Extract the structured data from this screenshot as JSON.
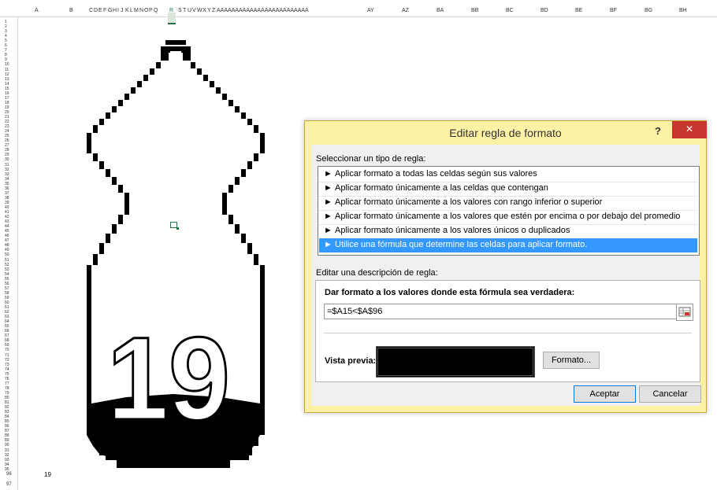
{
  "sheet": {
    "column_headers": [
      "A",
      "B",
      "C",
      "D",
      "E",
      "F",
      "G",
      "H",
      "I",
      "J",
      "K",
      "L",
      "M",
      "N",
      "O",
      "P",
      "Q",
      "R",
      "S",
      "T",
      "U",
      "V",
      "W",
      "X",
      "Y",
      "Z",
      "AAAAAAAAAAAAAAAAAAAAAAAAA",
      "AY",
      "AZ",
      "BA",
      "BB",
      "BC",
      "BD",
      "BE",
      "BF",
      "BG",
      "BH"
    ],
    "row_96_label": "96",
    "row_97_label": "97",
    "cell_a96_value": "19",
    "big_number": "19"
  },
  "dialog": {
    "title": "Editar regla de formato",
    "help_label": "?",
    "close_label": "✕",
    "select_rule_type_label": "Seleccionar un tipo de regla:",
    "rule_types": [
      "Aplicar formato a todas las celdas según sus valores",
      "Aplicar formato únicamente a las celdas que contengan",
      "Aplicar formato únicamente a los valores con rango inferior o superior",
      "Aplicar formato únicamente a los valores que estén por encima o por debajo del promedio",
      "Aplicar formato únicamente a los valores únicos o duplicados",
      "Utilice una fórmula que determine las celdas para aplicar formato."
    ],
    "selected_rule_index": 5,
    "rule_bullet": "►",
    "edit_description_label": "Editar una descripción de regla:",
    "formula_label": "Dar formato a los valores donde esta fórmula sea verdadera:",
    "formula_value": "=$A15<$A$96",
    "preview_label": "Vista previa:",
    "format_button": "Formato...",
    "ok_button": "Aceptar",
    "cancel_button": "Cancelar"
  },
  "colors": {
    "dialog_frame": "#fdf1a6",
    "close_button": "#c7372f",
    "selection": "#3399ff",
    "excel_green": "#217346"
  }
}
